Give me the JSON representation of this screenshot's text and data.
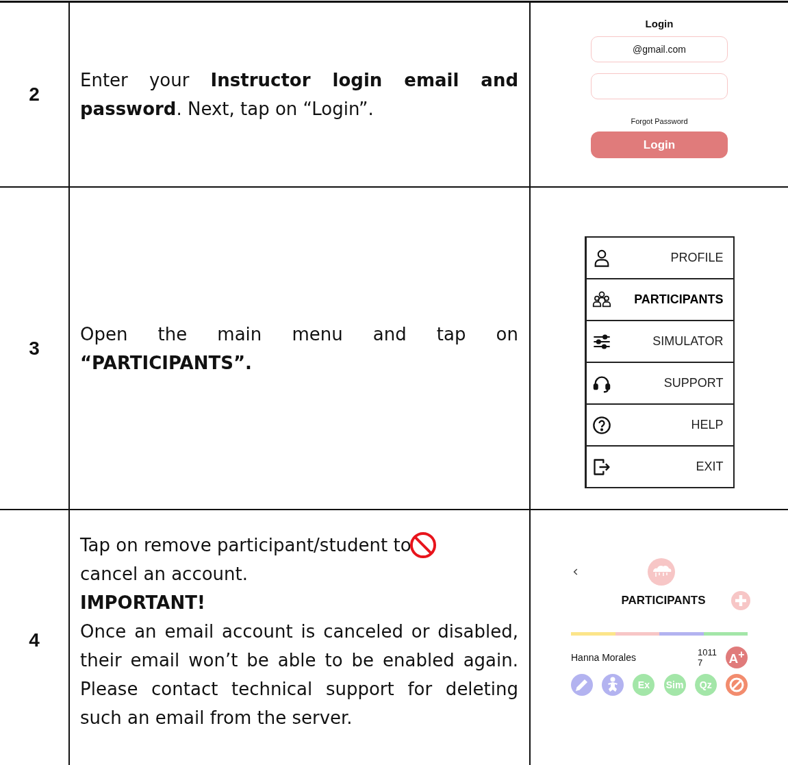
{
  "steps": [
    {
      "number": "2",
      "paragraphs": [
        {
          "kind": "text",
          "text": "Enter your **Instructor login email and password**. Next, tap on “Login”."
        }
      ],
      "screen": {
        "kind": "login",
        "title": "Login",
        "email_value": "@gmail.com",
        "forgot_link": "Forgot Password",
        "button": "Login",
        "button_disabled": true
      }
    },
    {
      "number": "3",
      "paragraphs": [
        {
          "kind": "text",
          "text": "Open the main menu and tap on **“PARTICIPANTS”.**"
        }
      ],
      "screen": {
        "kind": "menu",
        "items": [
          {
            "label": "PROFILE",
            "selected": false
          },
          {
            "label": "PARTICIPANTS",
            "selected": true
          },
          {
            "label": "SIMULATOR",
            "selected": false
          },
          {
            "label": "SUPPORT",
            "selected": false
          },
          {
            "label": "HELP",
            "selected": false
          },
          {
            "label": "EXIT",
            "selected": false
          }
        ]
      }
    },
    {
      "number": "4",
      "paragraphs": [
        {
          "kind": "icon_text",
          "before": "Tap on remove participant/student to",
          "after": "cancel an account."
        },
        {
          "kind": "heading",
          "text": "IMPORTANT!"
        },
        {
          "kind": "text",
          "text": "Once an email account is canceled or disabled, their email won’t be able to be enabled again. Please contact technical support for deleting such an email from the server."
        }
      ],
      "screen": {
        "kind": "participants",
        "title": "PARTICIPANTS",
        "color_bar": [
          {
            "color": "#fce58a"
          },
          {
            "color": "#f7c6c6"
          },
          {
            "color": "#b3b3f0"
          },
          {
            "color": "#a3e6a8"
          }
        ],
        "participant": {
          "name": "Hanna Morales",
          "id": "10117",
          "grade_button": "A$^{+}$"
        },
        "actions": [
          {
            "kind": "edit",
            "color": "#b3b3f0"
          },
          {
            "kind": "child",
            "color": "#b3b3f0"
          },
          {
            "kind": "text",
            "label": "Ex",
            "color": "#a3e6a8"
          },
          {
            "kind": "text",
            "label": "Sim",
            "color": "#a3e6a8"
          },
          {
            "kind": "text",
            "label": "Qz",
            "color": "#a3e6a8"
          },
          {
            "kind": "remove",
            "color": "#f28c6e"
          }
        ]
      }
    }
  ]
}
